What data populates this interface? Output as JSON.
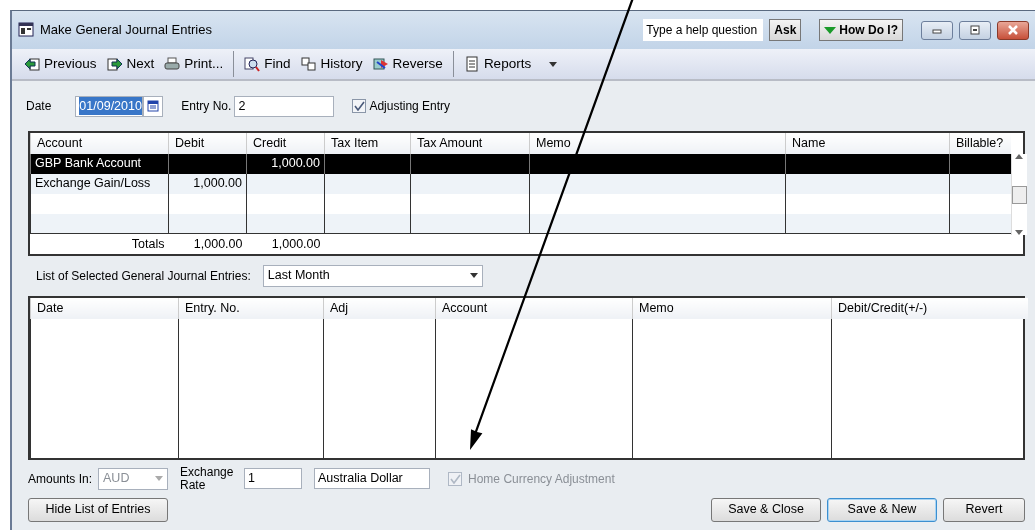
{
  "window": {
    "title": "Make General Journal Entries"
  },
  "help": {
    "placeholder": "Type a help question",
    "ask": "Ask",
    "how_do_i": "How Do I?"
  },
  "toolbar": {
    "groups": [
      [
        {
          "label": "Previous",
          "kind": "prev"
        },
        {
          "label": "Next",
          "kind": "next"
        },
        {
          "label": "Print...",
          "kind": "print"
        }
      ],
      [
        {
          "label": "Find",
          "kind": "find"
        },
        {
          "label": "History",
          "kind": "history"
        },
        {
          "label": "Reverse",
          "kind": "reverse"
        }
      ],
      [
        {
          "label": "Reports",
          "kind": "reports",
          "dropdown": true
        }
      ]
    ]
  },
  "form": {
    "date": {
      "label": "Date",
      "value": "01/09/2010",
      "selected": true
    },
    "entry_no": {
      "label": "Entry No.",
      "value": "2"
    },
    "adjusting_entry": {
      "label": "Adjusting Entry",
      "checked": true
    }
  },
  "journal": {
    "columns": [
      "Account",
      "Debit",
      "Credit",
      "Tax Item",
      "Tax Amount",
      "Memo",
      "Name",
      "Billable?"
    ],
    "rows": [
      {
        "cells": [
          "GBP Bank Account",
          "",
          "1,000.00",
          "",
          "",
          "",
          "",
          ""
        ],
        "selected": true
      },
      {
        "cells": [
          "Exchange Gain/Loss",
          "1,000.00",
          "",
          "",
          "",
          "",
          "",
          ""
        ],
        "selected": false
      }
    ],
    "totals": {
      "label": "Totals",
      "debit": "1,000.00",
      "credit": "1,000.00"
    }
  },
  "entries_list": {
    "label": "List of Selected General Journal Entries:",
    "filter": "Last Month",
    "columns": [
      "Date",
      "Entry. No.",
      "Adj",
      "Account",
      "Memo",
      "Debit/Credit(+/-)"
    ]
  },
  "footer": {
    "amounts_in": {
      "label": "Amounts In:",
      "value": "AUD",
      "disabled": true
    },
    "exchange_rate": {
      "label": "Exchange Rate",
      "value": "1"
    },
    "currency_name": "Australia Dollar",
    "home_currency_adjustment": {
      "label": "Home Currency Adjustment",
      "checked": true,
      "disabled": true
    }
  },
  "buttons": [
    {
      "label": "Hide List of Entries",
      "default": false
    },
    {
      "label": "Save & Close",
      "default": false
    },
    {
      "label": "Save & New",
      "default": true
    },
    {
      "label": "Revert",
      "default": false
    }
  ]
}
